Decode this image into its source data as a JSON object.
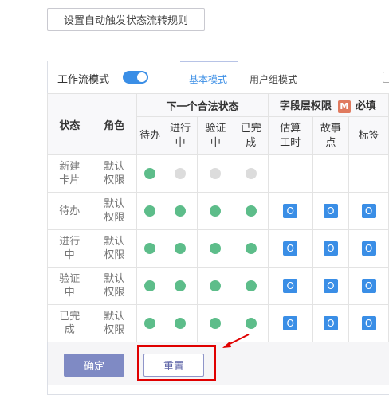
{
  "rules_button": "设置自动触发状态流转规则",
  "workflow_mode_label": "工作流模式",
  "workflow_toggle": "on",
  "tabs": [
    "基本模式",
    "用户组模式"
  ],
  "table": {
    "col_state": "状态",
    "col_role": "角色",
    "group_next_state": "下一个合法状态",
    "group_field_permission": "字段层权限",
    "group_required_badge": "M",
    "group_required_label": "必填",
    "next_states": [
      "待办",
      "进行中",
      "验证中",
      "已完成"
    ],
    "fields": [
      "估算工时",
      "故事点",
      "标签"
    ],
    "permission_symbol": "O",
    "rows": [
      {
        "state": "新建卡片",
        "role": "默认权限",
        "next": [
          true,
          false,
          false,
          false
        ],
        "fields": [
          false,
          false,
          false
        ]
      },
      {
        "state": "待办",
        "role": "默认权限",
        "next": [
          true,
          true,
          true,
          true
        ],
        "fields": [
          true,
          true,
          true
        ]
      },
      {
        "state": "进行中",
        "role": "默认权限",
        "next": [
          true,
          true,
          true,
          true
        ],
        "fields": [
          true,
          true,
          true
        ]
      },
      {
        "state": "验证中",
        "role": "默认权限",
        "next": [
          true,
          true,
          true,
          true
        ],
        "fields": [
          true,
          true,
          true
        ]
      },
      {
        "state": "已完成",
        "role": "默认权限",
        "next": [
          true,
          true,
          true,
          true
        ],
        "fields": [
          true,
          true,
          true
        ]
      }
    ]
  },
  "confirm_button": "确定",
  "reset_button": "重置",
  "colors": {
    "accent": "#3a8ee6",
    "enabled_dot": "#5dbd8a",
    "disabled_dot": "#dcdcdc",
    "highlight": "#e00000"
  }
}
